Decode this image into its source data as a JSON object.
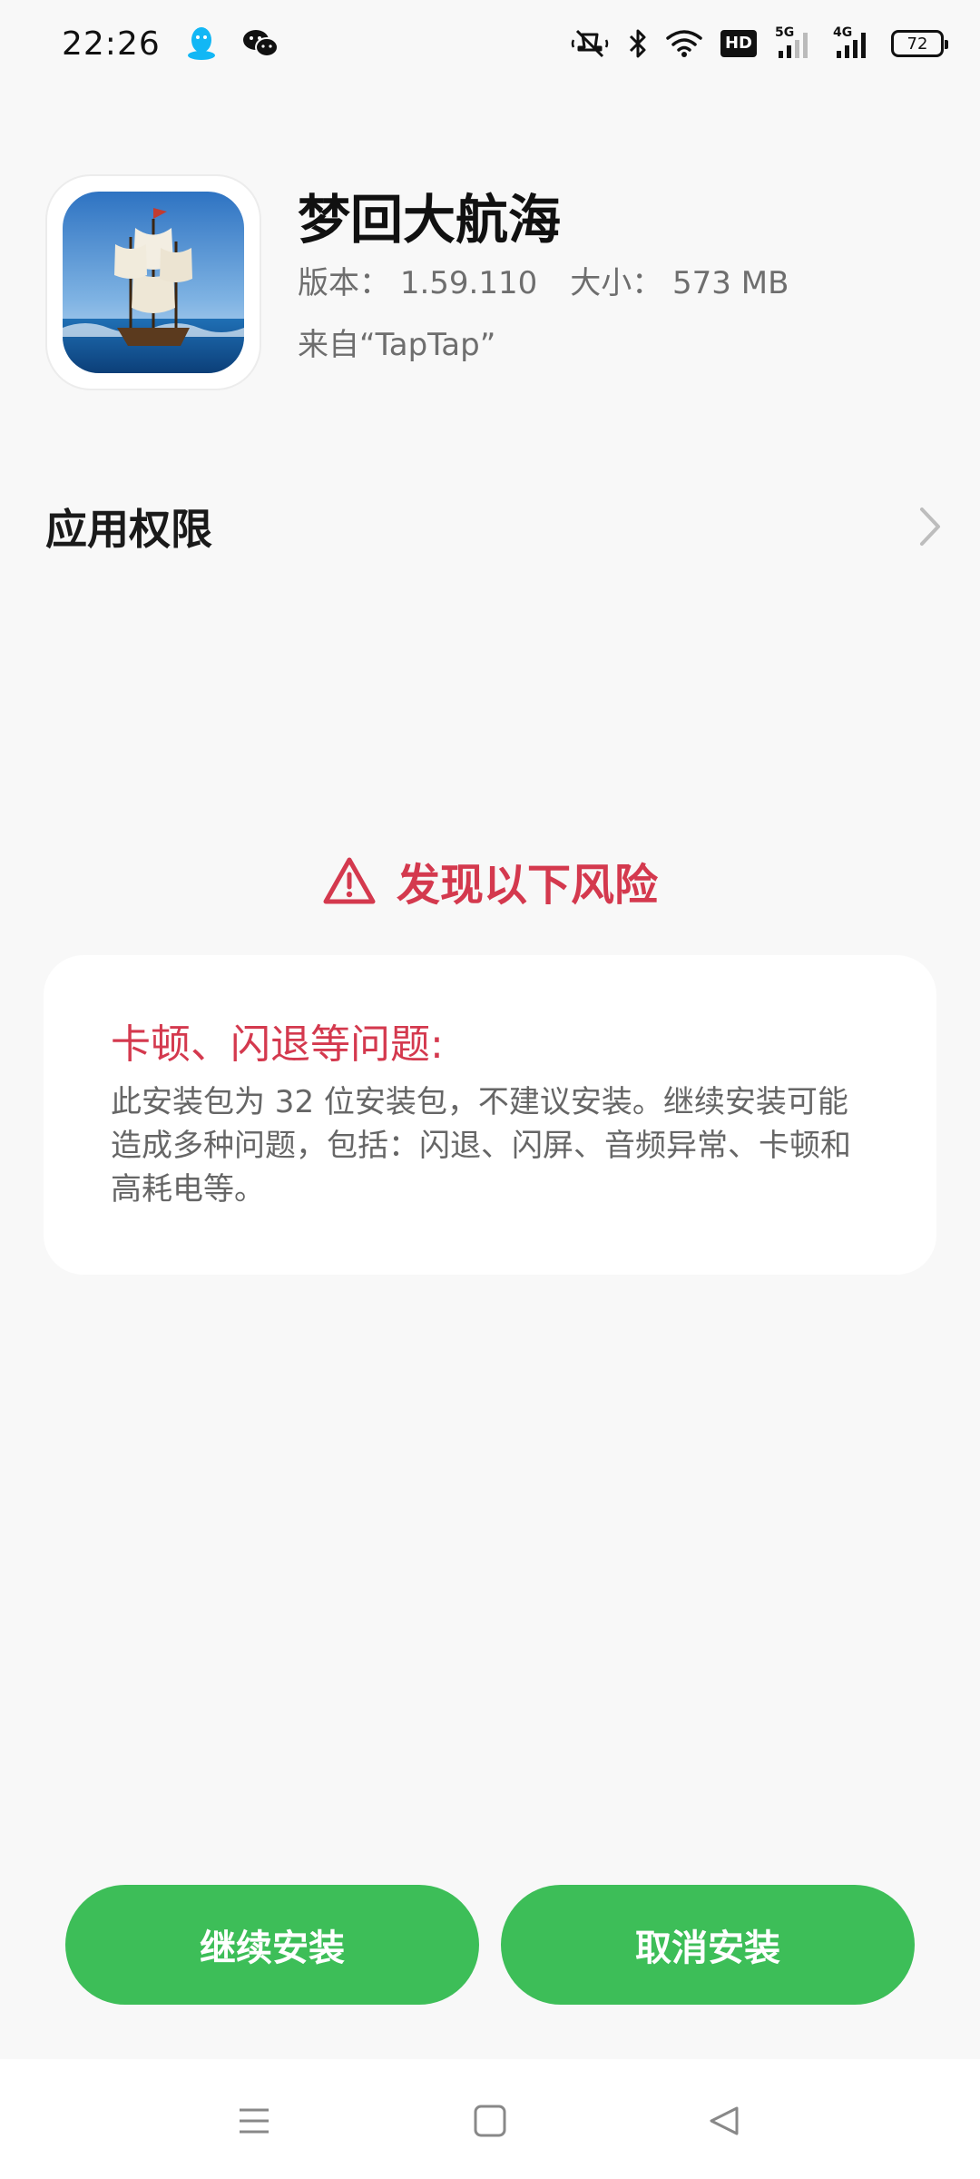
{
  "status_bar": {
    "time": "22:26",
    "left_icons": [
      "qq-icon",
      "wechat-icon"
    ],
    "right_icons": [
      "mute-icon",
      "bluetooth-icon",
      "wifi-icon",
      "hd-icon",
      "signal-5g-icon",
      "signal-4g-icon",
      "battery-icon"
    ],
    "hd_label": "HD",
    "net_5g": "5G",
    "net_4g": "4G",
    "battery_level": "72"
  },
  "app": {
    "name": "梦回大航海",
    "version_label": "版本：",
    "version": "1.59.110",
    "size_label": "大小：",
    "size": "573 MB",
    "source": "来自“TapTap”"
  },
  "permissions": {
    "label": "应用权限"
  },
  "risk": {
    "heading": "发现以下风险",
    "issue_title": "卡顿、闪退等问题:",
    "issue_desc": "此安装包为 32 位安装包，不建议安装。继续安装可能造成多种问题，包括：闪退、闪屏、音频异常、卡顿和高耗电等。"
  },
  "actions": {
    "continue_label": "继续安装",
    "cancel_label": "取消安装"
  },
  "colors": {
    "accent_green": "#3dbe58",
    "risk_red": "#d4394e",
    "background": "#f8f8f8"
  }
}
